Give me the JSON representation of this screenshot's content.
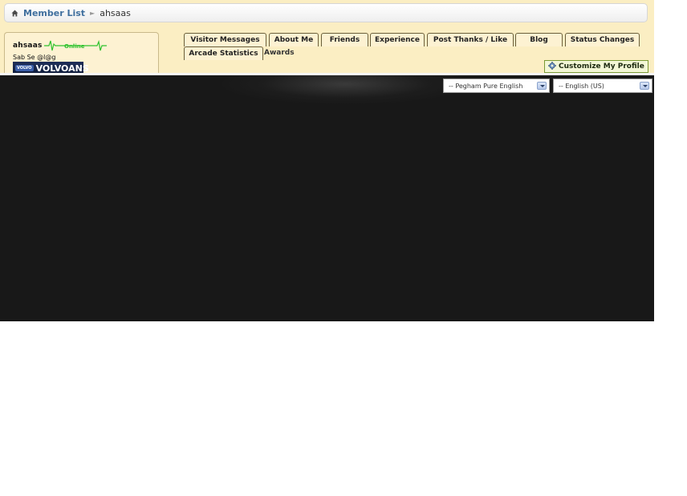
{
  "breadcrumb": {
    "home_icon": "home-icon",
    "link_label": "Member List",
    "current": "ahsaas"
  },
  "profile": {
    "username": "ahsaas",
    "status": "Online",
    "user_title": "Sab Se @l@g",
    "banner_text": "VOLVOANS",
    "banner_badge": "VOLVO"
  },
  "tabs": {
    "visitor_messages": "Visitor Messages",
    "about_me": "About Me",
    "friends": "Friends",
    "experience": "Experience",
    "post_thanks": "Post Thanks / Like",
    "blog": "Blog",
    "status_changes": "Status Changes",
    "arcade_statistics": "Arcade Statistics",
    "awards": "Awards"
  },
  "customize_button": {
    "label": "Customize My Profile",
    "icon": "cog-icon"
  },
  "footer": {
    "style_select": {
      "selected": "-- Pegham Pure English"
    },
    "language_select": {
      "selected": "-- English (US)"
    }
  },
  "colors": {
    "page_background": "#fbeec3",
    "link": "#3f6f9e",
    "pulse": "#2ec22e",
    "dark_footer": "#181818"
  }
}
